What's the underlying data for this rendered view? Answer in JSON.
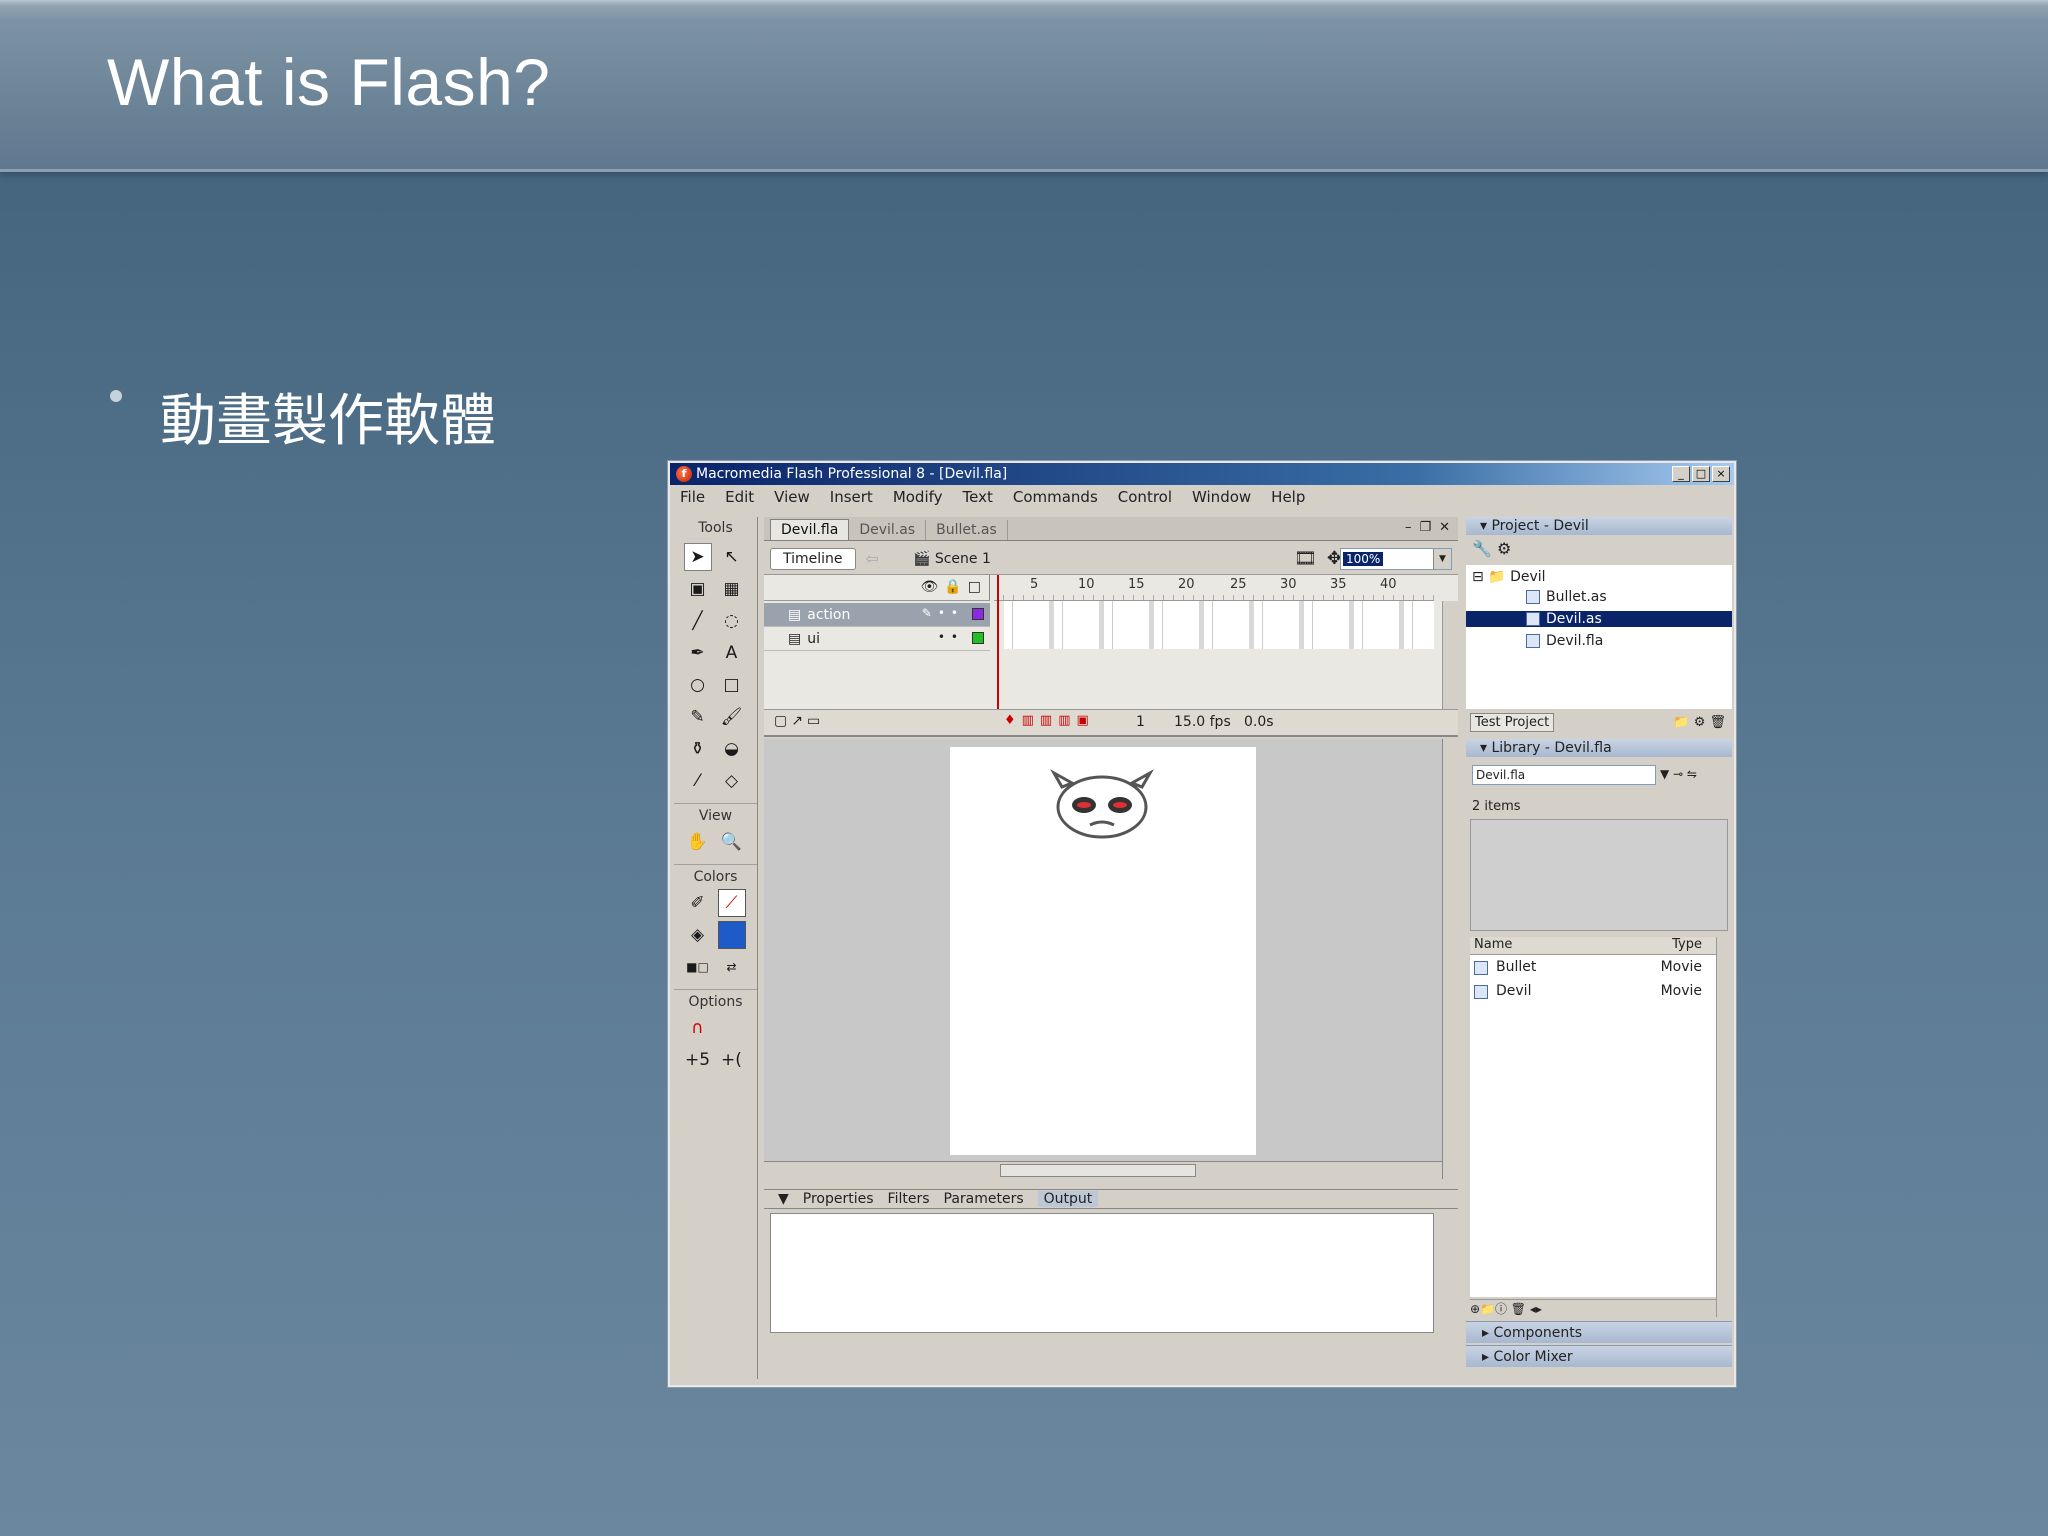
{
  "slide": {
    "title": "What is Flash?",
    "bullets": [
      "動畫製作軟體"
    ]
  },
  "flash": {
    "window_title": "Macromedia Flash Professional 8 - [Devil.fla]",
    "menu": [
      "File",
      "Edit",
      "View",
      "Insert",
      "Modify",
      "Text",
      "Commands",
      "Control",
      "Window",
      "Help"
    ],
    "tools": {
      "header": "Tools",
      "view_label": "View",
      "colors_label": "Colors",
      "options_label": "Options"
    },
    "doc_tabs": [
      "Devil.fla",
      "Devil.as",
      "Bullet.as"
    ],
    "timeline_button": "Timeline",
    "scene": "Scene 1",
    "zoom": "100%",
    "ruler": [
      "5",
      "10",
      "15",
      "20",
      "25",
      "30",
      "35",
      "40"
    ],
    "layers": [
      {
        "name": "action",
        "color": "#8a2be2"
      },
      {
        "name": "ui",
        "color": "#22c022"
      }
    ],
    "timeline_footer": {
      "frame": "1",
      "fps": "15.0 fps",
      "time": "0.0s"
    },
    "panel_tabs": [
      "Properties",
      "Filters",
      "Parameters",
      "Output"
    ],
    "project": {
      "header": "Project - Devil",
      "root": "Devil",
      "files": [
        "Bullet.as",
        "Devil.as",
        "Devil.fla"
      ],
      "selected_file": "Devil.as",
      "test_button": "Test Project"
    },
    "library": {
      "header": "Library - Devil.fla",
      "select_value": "Devil.fla",
      "items_label": "2 items",
      "col_name": "Name",
      "col_type": "Type",
      "items": [
        {
          "name": "Bullet",
          "type": "Movie"
        },
        {
          "name": "Devil",
          "type": "Movie"
        }
      ]
    },
    "collapsed_panels": [
      "Components",
      "Color Mixer"
    ]
  }
}
